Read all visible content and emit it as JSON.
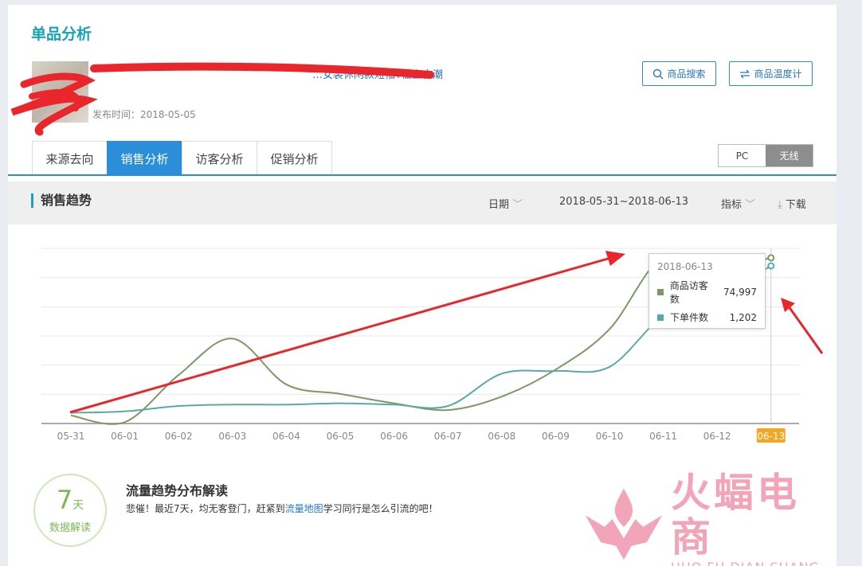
{
  "page": {
    "title": "单品分析",
    "product_title": "…女装休闲款短袖T恤上衣潮",
    "publish_time": "发布时间：2018-05-05"
  },
  "buttons": {
    "search": "商品搜索",
    "temperature": "商品温度计"
  },
  "tabs": [
    "来源去向",
    "销售分析",
    "访客分析",
    "促销分析"
  ],
  "active_tab": "销售分析",
  "device_toggle": {
    "pc": "PC",
    "wireless": "无线",
    "selected": "无线"
  },
  "trend": {
    "title": "销售趋势",
    "date_filter": "日期",
    "date_range": "2018-05-31~2018-06-13",
    "metric_filter": "指标",
    "download": "下载"
  },
  "chart_data": {
    "type": "line",
    "categories": [
      "05-31",
      "06-01",
      "06-02",
      "06-03",
      "06-04",
      "06-05",
      "06-06",
      "06-07",
      "06-08",
      "06-09",
      "06-10",
      "06-11",
      "06-12",
      "06-13"
    ],
    "highlighted_category": "06-13",
    "series": [
      {
        "name": "商品访客数",
        "color": "#7a9a62",
        "values": [
          6,
          1,
          36,
          63,
          29,
          22,
          15,
          10,
          20,
          40,
          70,
          124,
          115,
          123
        ]
      },
      {
        "name": "下单件数",
        "color": "#5aa9a7",
        "values": [
          8,
          9,
          13,
          14,
          14,
          15,
          14,
          13,
          37,
          39,
          42,
          80,
          95,
          117
        ]
      }
    ],
    "grid": true,
    "tooltip": {
      "date": "2018-06-13",
      "rows": [
        {
          "label": "商品访客数",
          "value": "74,997",
          "color": "#7a9a62"
        },
        {
          "label": "下单件数",
          "value": "1,202",
          "color": "#5aa9a7"
        }
      ]
    }
  },
  "interpretation": {
    "badge_number": "7",
    "badge_unit": "天",
    "badge_label": "数据解读",
    "title": "流量趋势分布解读",
    "text_before": "悲催！最近7天，均无客登门，赶紧到",
    "link": "流量地图",
    "text_after": "学习同行是怎么引流的吧！"
  },
  "watermark": {
    "cn": "火蝠电商",
    "en": "HUO FU DIAN SHANG"
  }
}
